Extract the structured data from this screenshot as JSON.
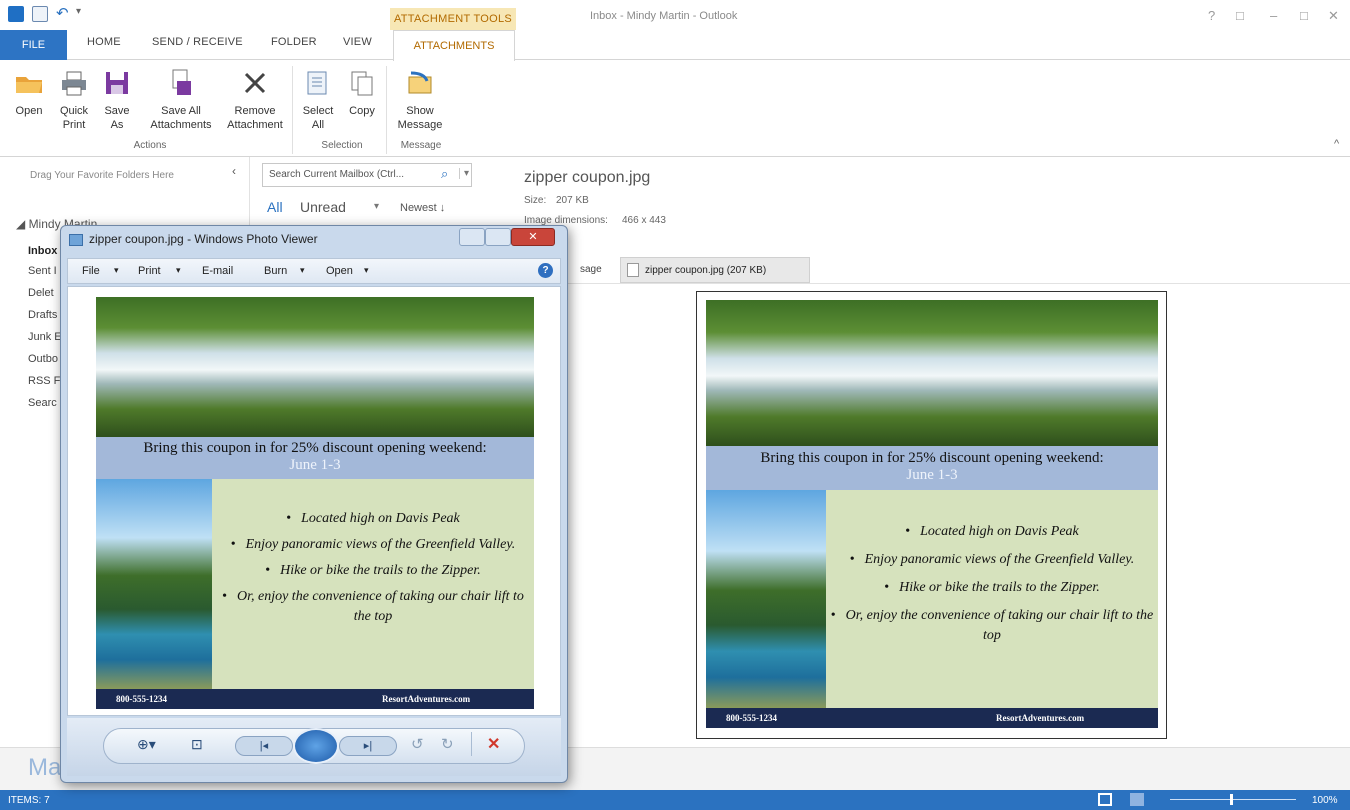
{
  "titlebar": {
    "contextual_group": "ATTACHMENT TOOLS",
    "window_title": "Inbox - Mindy Martin - Outlook",
    "help": "?",
    "restore": "□",
    "minimize": "–",
    "maximize": "□",
    "close": "✕"
  },
  "tabs": {
    "file": "FILE",
    "home": "HOME",
    "send_receive": "SEND / RECEIVE",
    "folder": "FOLDER",
    "view": "VIEW",
    "attachments": "ATTACHMENTS"
  },
  "ribbon": {
    "open": "Open",
    "quick_print_1": "Quick",
    "quick_print_2": "Print",
    "save_as_1": "Save",
    "save_as_2": "As",
    "save_all_1": "Save All",
    "save_all_2": "Attachments",
    "remove_1": "Remove",
    "remove_2": "Attachment",
    "select_all_1": "Select",
    "select_all_2": "All",
    "copy": "Copy",
    "show_1": "Show",
    "show_2": "Message",
    "show_3": "Message",
    "group_actions": "Actions",
    "group_selection": "Selection"
  },
  "nav": {
    "drag_hint": "Drag Your Favorite Folders Here",
    "account": "◢ Mindy Martin",
    "folders": [
      "Inbox",
      "Sent I",
      "Delet",
      "Drafts",
      "Junk E",
      "Outbo",
      "RSS F",
      "Searc"
    ],
    "mail_label": "Ma"
  },
  "list": {
    "search_placeholder": "Search Current Mailbox (Ctrl...",
    "filter_all": "All",
    "filter_unread": "Unread",
    "sort": "Newest ↓"
  },
  "reading": {
    "file_name": "zipper coupon.jpg",
    "size_label": "Size:",
    "size_value": "207 KB",
    "dims_label": "Image dimensions:",
    "dims_value": "466 x 443",
    "tab_message": "sage",
    "tab_attachment": "zipper coupon.jpg (207 KB)"
  },
  "viewer": {
    "title": "zipper coupon.jpg - Windows Photo Viewer",
    "menu_file": "File",
    "menu_print": "Print",
    "menu_email": "E-mail",
    "menu_burn": "Burn",
    "menu_open": "Open"
  },
  "coupon": {
    "headline": "Bring this coupon in for 25% discount opening weekend:",
    "dates": "June 1-3",
    "bullets": [
      "Located high on Davis Peak",
      "Enjoy panoramic views of the Greenfield Valley.",
      "Hike or bike the trails to the Zipper.",
      "Or, enjoy the convenience of taking our chair lift to the top"
    ],
    "phone": "800-555-1234",
    "website": "ResortAdventures.com"
  },
  "status": {
    "items": "ITEMS: 7",
    "zoom": "100%"
  },
  "colors": {
    "accent": "#2b72c0",
    "contextual": "#b26a00",
    "coupon_banner": "#a3b8d9",
    "coupon_list": "#d6e2bd",
    "coupon_footer": "#1b2a52"
  }
}
